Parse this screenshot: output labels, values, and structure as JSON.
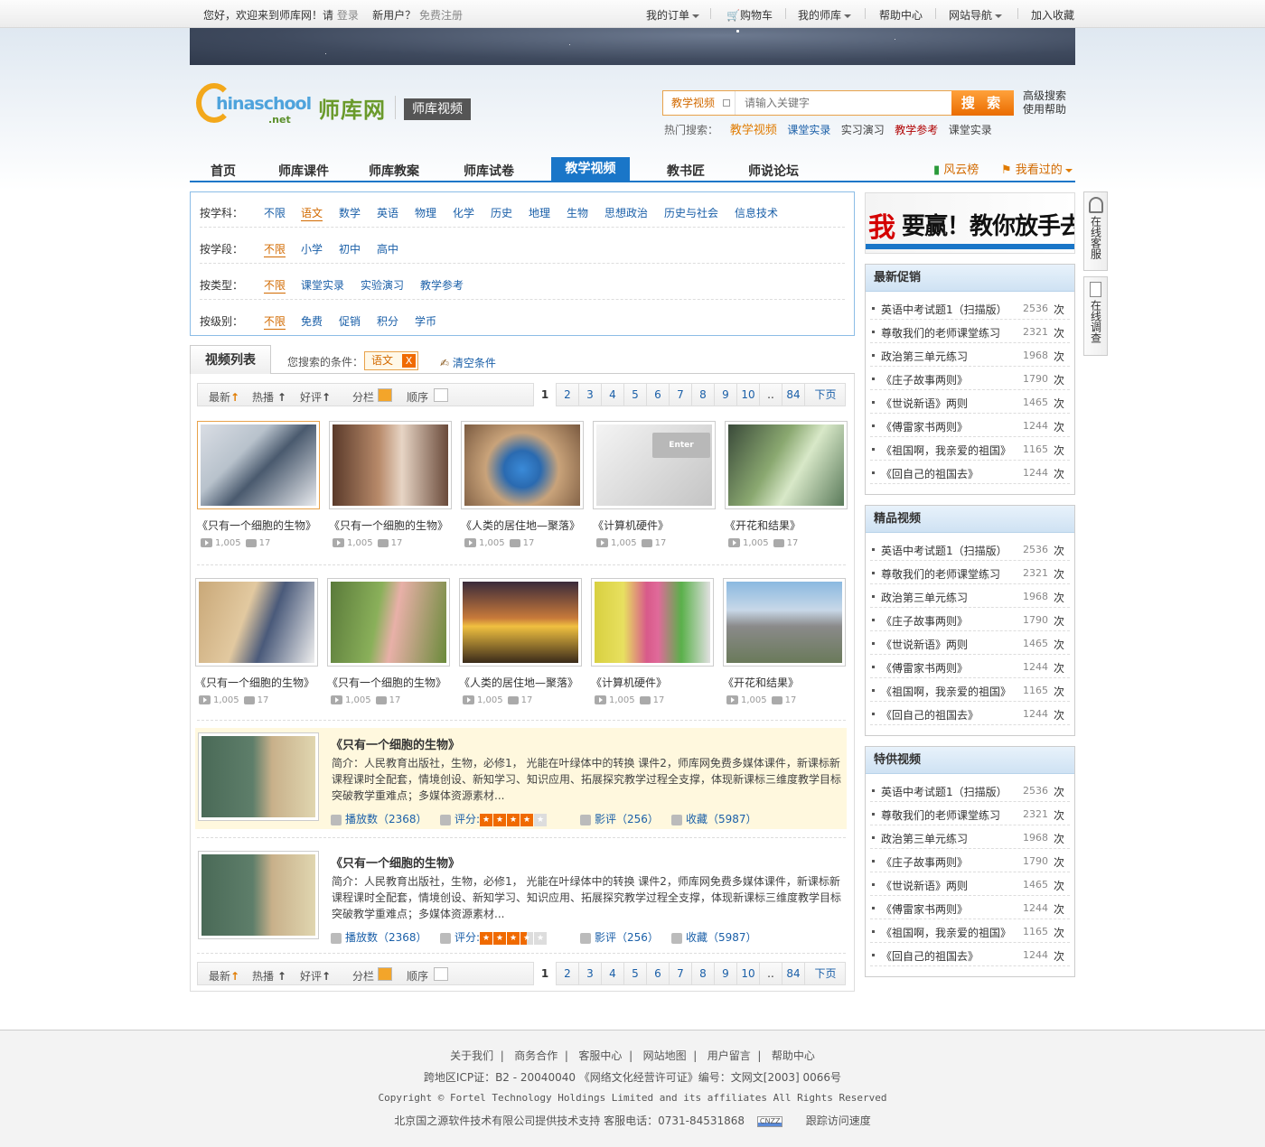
{
  "topbar": {
    "welcome": "您好，欢迎来到师库网！请",
    "login": "登录",
    "new_user": "新用户？",
    "register": "免费注册",
    "my_orders": "我的订单",
    "cart": "购物车",
    "my_shiku": "我的师库",
    "help": "帮助中心",
    "site_nav": "网站导航",
    "favorite": "加入收藏"
  },
  "header": {
    "logo_text": "hinaschool",
    "logo_net": ".net",
    "brand": "师库网",
    "section": "师库视频"
  },
  "search": {
    "category": "教学视频",
    "placeholder": "请输入关键字",
    "button": "搜 索",
    "advanced": "高级搜索",
    "help": "使用帮助",
    "hot_label": "热门搜索：",
    "hot": [
      "教学视频",
      "课堂实录",
      "实习演习",
      "教学参考",
      "课堂实录"
    ]
  },
  "nav": {
    "items": [
      "首页",
      "师库课件",
      "师库教案",
      "师库试卷",
      "教学视频",
      "教书匠",
      "师说论坛"
    ],
    "active": "教学视频",
    "ranking": "风云榜",
    "viewed": "我看过的"
  },
  "filters": {
    "subject": {
      "label": "按学科：",
      "options": [
        "不限",
        "语文",
        "数学",
        "英语",
        "物理",
        "化学",
        "历史",
        "地理",
        "生物",
        "思想政治",
        "历史与社会",
        "信息技术"
      ]
    },
    "stage": {
      "label": "按学段：",
      "options": [
        "不限",
        "小学",
        "初中",
        "高中"
      ]
    },
    "type": {
      "label": "按类型：",
      "options": [
        "不限",
        "课堂实录",
        "实验演习",
        "教学参考"
      ]
    },
    "level": {
      "label": "按级别：",
      "options": [
        "不限",
        "免费",
        "促销",
        "积分",
        "学币"
      ]
    }
  },
  "list": {
    "tab": "视频列表",
    "cond_label": "您搜索的条件：",
    "cond_value": "语文",
    "cond_remove": "X",
    "clear": "清空条件"
  },
  "sortbar": {
    "newest": "最新",
    "hot": "热播",
    "rating": "好评",
    "column": "分栏",
    "order": "顺序",
    "pages": [
      "1",
      "2",
      "3",
      "4",
      "5",
      "6",
      "7",
      "8",
      "9",
      "10",
      "..",
      "84",
      "下页"
    ],
    "current_page": "1"
  },
  "videos": [
    {
      "title": "《只有一个细胞的生物》",
      "plays": "1,005",
      "comments": "17"
    },
    {
      "title": "《只有一个细胞的生物》",
      "plays": "1,005",
      "comments": "17"
    },
    {
      "title": "《人类的居住地—聚落》",
      "plays": "1,005",
      "comments": "17"
    },
    {
      "title": "《计算机硬件》",
      "plays": "1,005",
      "comments": "17"
    },
    {
      "title": "《开花和结果》",
      "plays": "1,005",
      "comments": "17"
    },
    {
      "title": "《只有一个细胞的生物》",
      "plays": "1,005",
      "comments": "17"
    },
    {
      "title": "《只有一个细胞的生物》",
      "plays": "1,005",
      "comments": "17"
    },
    {
      "title": "《人类的居住地—聚落》",
      "plays": "1,005",
      "comments": "17"
    },
    {
      "title": "《计算机硬件》",
      "plays": "1,005",
      "comments": "17"
    },
    {
      "title": "《开花和结果》",
      "plays": "1,005",
      "comments": "17"
    }
  ],
  "thumb_overlay": "Enter",
  "details": [
    {
      "title": "《只有一个细胞的生物》",
      "desc": "简介：人民教育出版社，生物，必修1， 光能在叶绿体中的转换 课件2，师库网免费多媒体课件，新课标新课程课时全配套，情境创设、新知学习、知识应用、拓展探究教学过程全支撑，体现新课标三维度教学目标突破教学重难点；多媒体资源素材...",
      "plays": "播放数（2368）",
      "rating_label": "评分:",
      "rating": 4,
      "reviews": "影评（256）",
      "favorites": "收藏（5987）"
    },
    {
      "title": "《只有一个细胞的生物》",
      "desc": "简介：人民教育出版社，生物，必修1， 光能在叶绿体中的转换 课件2，师库网免费多媒体课件，新课标新课程课时全配套，情境创设、新知学习、知识应用、拓展探究教学过程全支撑，体现新课标三维度教学目标突破教学重难点；多媒体资源素材...",
      "plays": "播放数（2368）",
      "rating_label": "评分:",
      "rating": 3.5,
      "reviews": "影评（256）",
      "favorites": "收藏（5987）"
    }
  ],
  "ad": {
    "big": "我",
    "rest": "要赢！教你放手去搏！"
  },
  "side_float": {
    "service": "在线客服",
    "survey": "在线调查"
  },
  "rank_unit": "次",
  "rank_boxes": [
    {
      "title": "最新促销",
      "items": [
        {
          "name": "英语中考试题1（扫描版）",
          "count": "2536"
        },
        {
          "name": "尊敬我们的老师课堂练习",
          "count": "2321"
        },
        {
          "name": "政治第三单元练习",
          "count": "1968"
        },
        {
          "name": "《庄子故事两则》",
          "count": "1790"
        },
        {
          "name": "《世说新语》两则",
          "count": "1465"
        },
        {
          "name": "《傅雷家书两则》",
          "count": "1244"
        },
        {
          "name": "《祖国啊，我亲爱的祖国》",
          "count": "1165"
        },
        {
          "name": "《回自己的祖国去》",
          "count": "1244"
        }
      ]
    },
    {
      "title": "精品视频",
      "items": [
        {
          "name": "英语中考试题1（扫描版）",
          "count": "2536"
        },
        {
          "name": "尊敬我们的老师课堂练习",
          "count": "2321"
        },
        {
          "name": "政治第三单元练习",
          "count": "1968"
        },
        {
          "name": "《庄子故事两则》",
          "count": "1790"
        },
        {
          "name": "《世说新语》两则",
          "count": "1465"
        },
        {
          "name": "《傅雷家书两则》",
          "count": "1244"
        },
        {
          "name": "《祖国啊，我亲爱的祖国》",
          "count": "1165"
        },
        {
          "name": "《回自己的祖国去》",
          "count": "1244"
        }
      ]
    },
    {
      "title": "特供视频",
      "items": [
        {
          "name": "英语中考试题1（扫描版）",
          "count": "2536"
        },
        {
          "name": "尊敬我们的老师课堂练习",
          "count": "2321"
        },
        {
          "name": "政治第三单元练习",
          "count": "1968"
        },
        {
          "name": "《庄子故事两则》",
          "count": "1790"
        },
        {
          "name": "《世说新语》两则",
          "count": "1465"
        },
        {
          "name": "《傅雷家书两则》",
          "count": "1244"
        },
        {
          "name": "《祖国啊，我亲爱的祖国》",
          "count": "1165"
        },
        {
          "name": "《回自己的祖国去》",
          "count": "1244"
        }
      ]
    }
  ],
  "footer": {
    "links": [
      "关于我们",
      "商务合作",
      "客服中心",
      "网站地图",
      "用户留言",
      "帮助中心"
    ],
    "icp": "跨地区ICP证：B2 - 20040040 《网络文化经营许可证》编号：文网文[2003] 0066号",
    "copyright": "Copyright © Fortel Technology Holdings Limited and its affiliates All Rights Reserved",
    "support": "北京国之源软件技术有限公司提供技术支持 客服电话：0731-84531868",
    "badge": "CNZZ",
    "tracking": "跟踪访问速度"
  },
  "colors": {
    "accent_blue": "#1a76c8",
    "accent_orange": "#f06a00",
    "link": "#1a5fa8"
  }
}
